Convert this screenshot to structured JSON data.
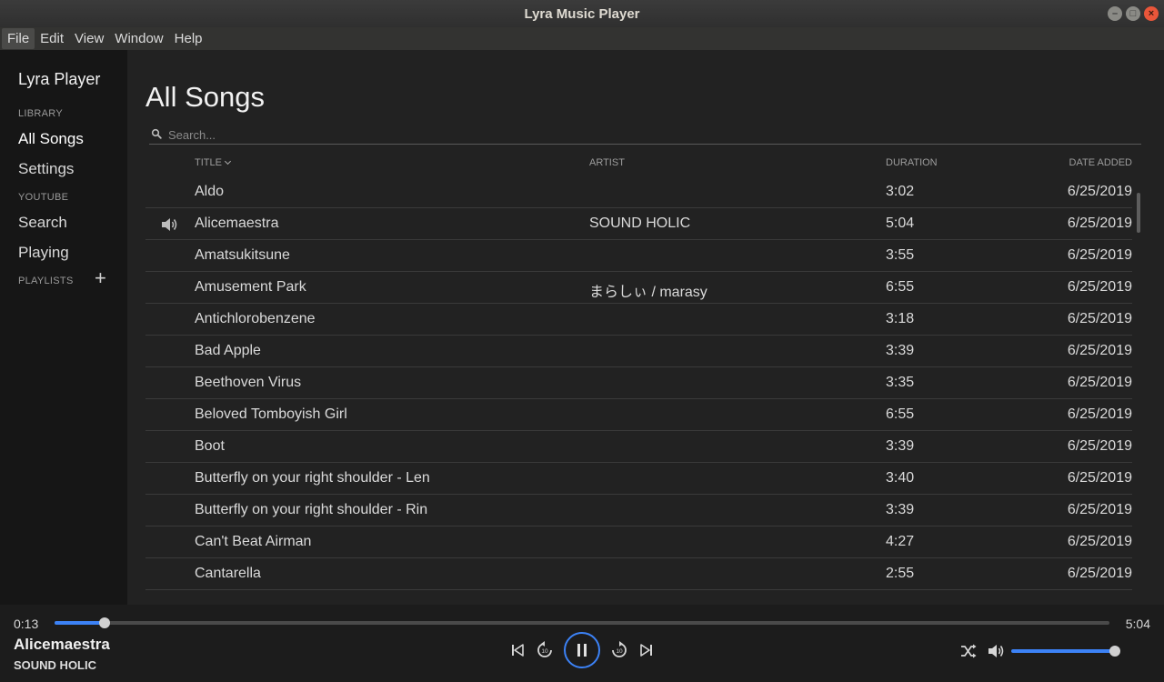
{
  "window": {
    "title": "Lyra Music Player"
  },
  "menubar": {
    "items": [
      "File",
      "Edit",
      "View",
      "Window",
      "Help"
    ]
  },
  "sidebar": {
    "brand": "Lyra Player",
    "library_label": "LIBRARY",
    "all_songs": "All Songs",
    "settings": "Settings",
    "youtube_label": "YOUTUBE",
    "search": "Search",
    "playing": "Playing",
    "playlists_label": "PLAYLISTS",
    "add_icon": "plus-icon"
  },
  "main": {
    "title": "All Songs",
    "search_placeholder": "Search...",
    "columns": {
      "title": "TITLE",
      "artist": "ARTIST",
      "duration": "DURATION",
      "date_added": "DATE ADDED"
    },
    "songs": [
      {
        "title": "Aldo",
        "artist": "",
        "duration": "3:02",
        "date": "6/25/2019"
      },
      {
        "title": "Alicemaestra",
        "artist": "SOUND HOLIC",
        "duration": "5:04",
        "date": "6/25/2019",
        "playing": true
      },
      {
        "title": "Amatsukitsune",
        "artist": "",
        "duration": "3:55",
        "date": "6/25/2019"
      },
      {
        "title": "Amusement Park",
        "artist": "まらしぃ / marasy",
        "duration": "6:55",
        "date": "6/25/2019"
      },
      {
        "title": "Antichlorobenzene",
        "artist": "",
        "duration": "3:18",
        "date": "6/25/2019"
      },
      {
        "title": "Bad Apple",
        "artist": "",
        "duration": "3:39",
        "date": "6/25/2019"
      },
      {
        "title": "Beethoven Virus",
        "artist": "",
        "duration": "3:35",
        "date": "6/25/2019"
      },
      {
        "title": "Beloved Tomboyish Girl",
        "artist": "",
        "duration": "6:55",
        "date": "6/25/2019"
      },
      {
        "title": "Boot",
        "artist": "",
        "duration": "3:39",
        "date": "6/25/2019"
      },
      {
        "title": "Butterfly on your right shoulder - Len",
        "artist": "",
        "duration": "3:40",
        "date": "6/25/2019"
      },
      {
        "title": "Butterfly on your right shoulder - Rin",
        "artist": "",
        "duration": "3:39",
        "date": "6/25/2019"
      },
      {
        "title": "Can't Beat Airman",
        "artist": "",
        "duration": "4:27",
        "date": "6/25/2019"
      },
      {
        "title": "Cantarella",
        "artist": "",
        "duration": "2:55",
        "date": "6/25/2019"
      }
    ]
  },
  "player": {
    "current_time": "0:13",
    "total_time": "5:04",
    "progress": 0.047,
    "now_playing_title": "Alicemaestra",
    "now_playing_artist": "SOUND HOLIC",
    "volume": 1.0,
    "accent_color": "#3c82f6",
    "icons": [
      "skip-previous-icon",
      "replay-10-icon",
      "pause-icon",
      "forward-10-icon",
      "skip-next-icon",
      "shuffle-icon",
      "volume-icon"
    ]
  }
}
